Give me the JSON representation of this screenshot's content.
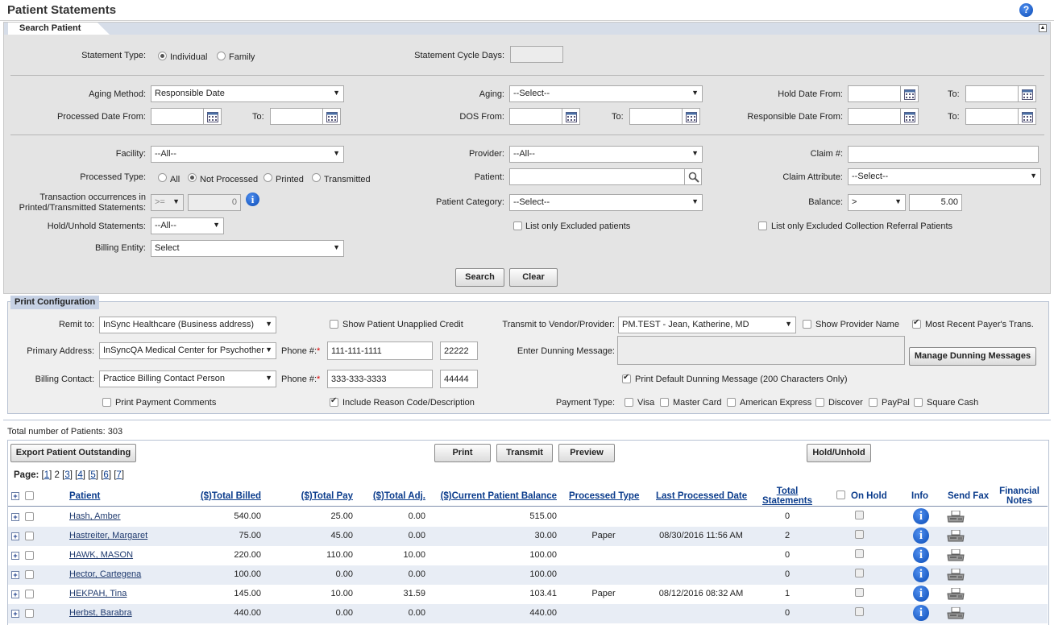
{
  "page_title": "Patient Statements",
  "search_tab": "Search Patient",
  "search": {
    "statement_type_label": "Statement Type:",
    "statement_type_options": [
      "Individual",
      "Family"
    ],
    "statement_cycle_days_label": "Statement Cycle Days:",
    "aging_method_label": "Aging Method:",
    "aging_method_value": "Responsible Date",
    "aging_label": "Aging:",
    "aging_value": "--Select--",
    "hold_date_from_label": "Hold Date From:",
    "to_label": "To:",
    "processed_date_from_label": "Processed Date From:",
    "dos_from_label": "DOS From:",
    "responsible_date_from_label": "Responsible Date From:",
    "facility_label": "Facility:",
    "facility_value": "--All--",
    "provider_label": "Provider:",
    "provider_value": "--All--",
    "claim_no_label": "Claim #:",
    "processed_type_label": "Processed Type:",
    "processed_type_options": [
      "All",
      "Not Processed",
      "Printed",
      "Transmitted"
    ],
    "patient_label": "Patient:",
    "claim_attribute_label": "Claim Attribute:",
    "claim_attribute_value": "--Select--",
    "transaction_label_1": "Transaction occurrences in",
    "transaction_label_2": "Printed/Transmitted Statements:",
    "transaction_operator": ">=",
    "transaction_value": "0",
    "patient_category_label": "Patient Category:",
    "patient_category_value": "--Select--",
    "balance_label": "Balance:",
    "balance_operator": ">",
    "balance_value": "5.00",
    "hold_unhold_label": "Hold/Unhold Statements:",
    "hold_unhold_value": "--All--",
    "list_excluded_label": "List only Excluded patients",
    "list_excluded_collection_label": "List only Excluded Collection Referral Patients",
    "billing_entity_label": "Billing Entity:",
    "billing_entity_value": "Select",
    "search_button": "Search",
    "clear_button": "Clear"
  },
  "print_config": {
    "title": "Print Configuration",
    "remit_to_label": "Remit to:",
    "remit_to_value": "InSync Healthcare (Business address)",
    "show_unapplied_label": "Show Patient Unapplied Credit",
    "transmit_label": "Transmit to Vendor/Provider:",
    "transmit_value": "PM.TEST - Jean, Katherine, MD",
    "show_provider_name_label": "Show Provider Name",
    "most_recent_label": "Most Recent Payer's Trans.",
    "primary_address_label": "Primary Address:",
    "primary_address_value": "InSyncQA Medical Center for Psychother",
    "phone_label": "Phone #:",
    "phone_1": "111-111-1111",
    "ext_1": "22222",
    "enter_dunning_label": "Enter Dunning Message:",
    "manage_dunning_button": "Manage Dunning Messages",
    "billing_contact_label": "Billing Contact:",
    "billing_contact_value": "Practice Billing Contact Person",
    "phone_2": "333-333-3333",
    "ext_2": "44444",
    "print_default_dunning_label": "Print Default Dunning Message (200 Characters Only)",
    "print_payment_comments_label": "Print Payment Comments",
    "include_reason_label": "Include Reason Code/Description",
    "payment_type_label": "Payment Type:",
    "payment_types": [
      "Visa",
      "Master Card",
      "American Express",
      "Discover",
      "PayPal",
      "Square Cash"
    ]
  },
  "results": {
    "total_label": "Total number of Patients: 303",
    "export_button": "Export Patient Outstanding",
    "print_button": "Print",
    "transmit_button": "Transmit",
    "preview_button": "Preview",
    "hold_button": "Hold/Unhold",
    "page_label": "Page:",
    "pages": [
      "1",
      "2",
      "3",
      "4",
      "5",
      "6",
      "7"
    ],
    "current_page": "2",
    "columns": {
      "patient": "Patient",
      "total_billed": "($)Total Billed",
      "total_pay": "($)Total Pay",
      "total_adj": "($)Total Adj.",
      "current_balance": "($)Current Patient Balance",
      "processed_type": "Processed Type",
      "last_processed": "Last Processed Date",
      "total_statements_1": "Total",
      "total_statements_2": "Statements",
      "on_hold": "On Hold",
      "info": "Info",
      "send_fax": "Send Fax",
      "financial_notes_1": "Financial",
      "financial_notes_2": "Notes"
    },
    "rows": [
      {
        "patient": "Hash, Amber",
        "billed": "540.00",
        "pay": "25.00",
        "adj": "0.00",
        "balance": "515.00",
        "ptype": "",
        "last": "",
        "stmts": "0"
      },
      {
        "patient": "Hastreiter, Margaret",
        "billed": "75.00",
        "pay": "45.00",
        "adj": "0.00",
        "balance": "30.00",
        "ptype": "Paper",
        "last": "08/30/2016 11:56 AM",
        "stmts": "2"
      },
      {
        "patient": "HAWK, MASON",
        "billed": "220.00",
        "pay": "110.00",
        "adj": "10.00",
        "balance": "100.00",
        "ptype": "",
        "last": "",
        "stmts": "0"
      },
      {
        "patient": "Hector, Cartegena",
        "billed": "100.00",
        "pay": "0.00",
        "adj": "0.00",
        "balance": "100.00",
        "ptype": "",
        "last": "",
        "stmts": "0"
      },
      {
        "patient": "HEKPAH, Tina",
        "billed": "145.00",
        "pay": "10.00",
        "adj": "31.59",
        "balance": "103.41",
        "ptype": "Paper",
        "last": "08/12/2016 08:32 AM",
        "stmts": "1"
      },
      {
        "patient": "Herbst, Barabra",
        "billed": "440.00",
        "pay": "0.00",
        "adj": "0.00",
        "balance": "440.00",
        "ptype": "",
        "last": "",
        "stmts": "0"
      }
    ]
  }
}
